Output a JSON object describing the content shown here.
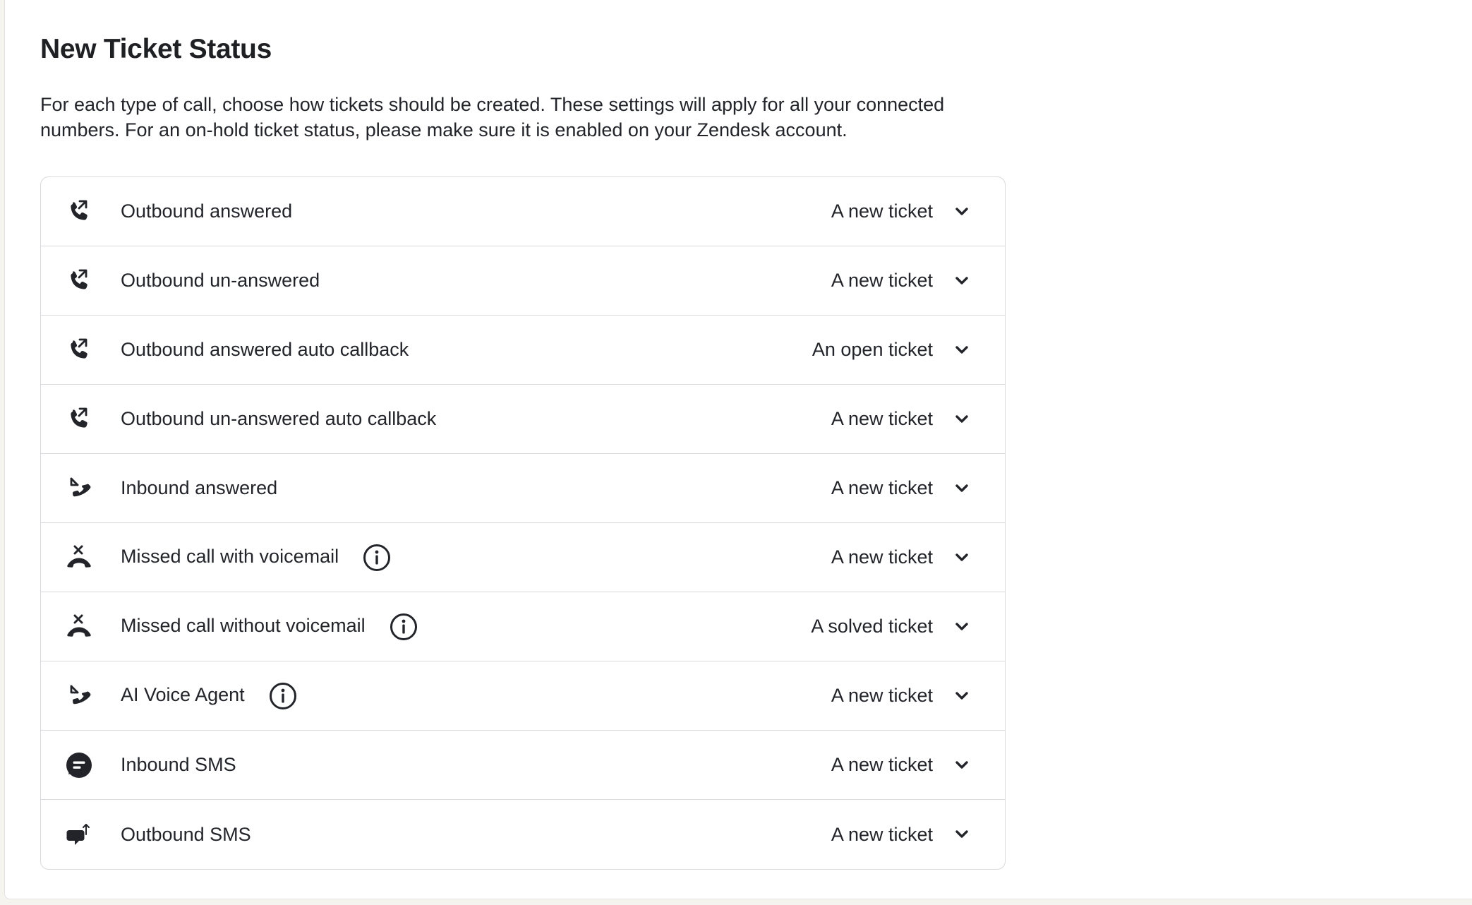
{
  "section": {
    "title": "New Ticket Status",
    "description": "For each type of call, choose how tickets should be created. These settings will apply for all your connected numbers. For an on-hold ticket status, please make sure it is enabled on your Zendesk account."
  },
  "rows": [
    {
      "label": "Outbound answered",
      "icon": "outbound-call-icon",
      "info": false,
      "status": "A new ticket"
    },
    {
      "label": "Outbound un-answered",
      "icon": "outbound-call-icon",
      "info": false,
      "status": "A new ticket"
    },
    {
      "label": "Outbound answered auto callback",
      "icon": "outbound-call-icon",
      "info": false,
      "status": "An open ticket"
    },
    {
      "label": "Outbound un-answered auto callback",
      "icon": "outbound-call-icon",
      "info": false,
      "status": "A new ticket"
    },
    {
      "label": "Inbound answered",
      "icon": "inbound-call-icon",
      "info": false,
      "status": "A new ticket"
    },
    {
      "label": "Missed call with voicemail",
      "icon": "missed-call-icon",
      "info": true,
      "status": "A new ticket"
    },
    {
      "label": "Missed call without voicemail",
      "icon": "missed-call-icon",
      "info": true,
      "status": "A solved ticket"
    },
    {
      "label": "AI Voice Agent",
      "icon": "inbound-call-icon",
      "info": true,
      "status": "A new ticket"
    },
    {
      "label": "Inbound SMS",
      "icon": "sms-icon",
      "info": false,
      "status": "A new ticket"
    },
    {
      "label": "Outbound SMS",
      "icon": "outbound-sms-icon",
      "info": false,
      "status": "A new ticket"
    }
  ],
  "icons": {
    "info": "info-icon",
    "dropdown": "chevron-down-icon"
  },
  "colors": {
    "text": "#22242a",
    "border": "#d8d9dc",
    "background": "#ffffff",
    "page_background": "#f6f4ef"
  }
}
